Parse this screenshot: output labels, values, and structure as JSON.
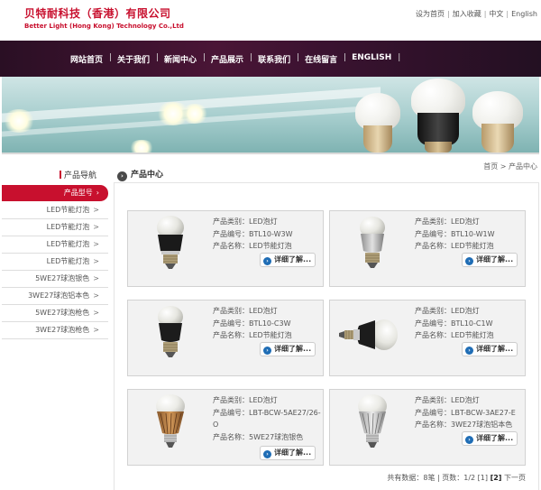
{
  "header": {
    "company_cn": "贝特耐科技（香港）有限公司",
    "company_en": "Better Light (Hong Kong) Technology Co.,Ltd",
    "links": [
      "设为首页",
      "加入收藏",
      "中文",
      "English"
    ]
  },
  "nav": [
    "网站首页",
    "关于我们",
    "新闻中心",
    "产品展示",
    "联系我们",
    "在线留言",
    "ENGLISH"
  ],
  "sidebar": {
    "title": "产品导航",
    "items": [
      {
        "label": "产品型号",
        "arrow": "›",
        "active": true
      },
      {
        "label": "LED节能灯泡",
        "arrow": ">"
      },
      {
        "label": "LED节能灯泡",
        "arrow": ">"
      },
      {
        "label": "LED节能灯泡",
        "arrow": ">"
      },
      {
        "label": "LED节能灯泡",
        "arrow": ">"
      },
      {
        "label": "5WE27球泡银色",
        "arrow": ">"
      },
      {
        "label": "3WE27球泡铝本色",
        "arrow": ">"
      },
      {
        "label": "5WE27球泡枪色",
        "arrow": ">"
      },
      {
        "label": "3WE27球泡枪色",
        "arrow": ">"
      }
    ]
  },
  "main": {
    "title": "产品中心",
    "breadcrumb": "首页 > 产品中心",
    "more_label": "详细了解...",
    "products": [
      {
        "category": "产品类别：LED泡灯",
        "code": "产品编号：BTL10-W3W",
        "name": "产品名称：LED节能灯泡"
      },
      {
        "category": "产品类别：LED泡灯",
        "code": "产品编号：BTL10-W1W",
        "name": "产品名称：LED节能灯泡"
      },
      {
        "category": "产品类别：LED泡灯",
        "code": "产品编号：BTL10-C3W",
        "name": "产品名称：LED节能灯泡"
      },
      {
        "category": "产品类别：LED泡灯",
        "code": "产品编号：BTL10-C1W",
        "name": "产品名称：LED节能灯泡"
      },
      {
        "category": "产品类别：LED泡灯",
        "code": "产品编号：LBT-BCW-5AE27/26-O",
        "name": "产品名称：5WE27球泡银色"
      },
      {
        "category": "产品类别：LED泡灯",
        "code": "产品编号：LBT-BCW-3AE27-E",
        "name": "产品名称：3WE27球泡铝本色"
      }
    ],
    "pager": {
      "total_text": "共有数据：8笔",
      "page_text": "页数：1/2",
      "pages": [
        "[1]",
        "[2]"
      ],
      "next": "下一页"
    }
  },
  "colors": {
    "brand_red": "#c8102e",
    "nav_bg": "#3a1230",
    "card_bg": "#f2f2f2",
    "more_icon": "#1f6db5"
  }
}
